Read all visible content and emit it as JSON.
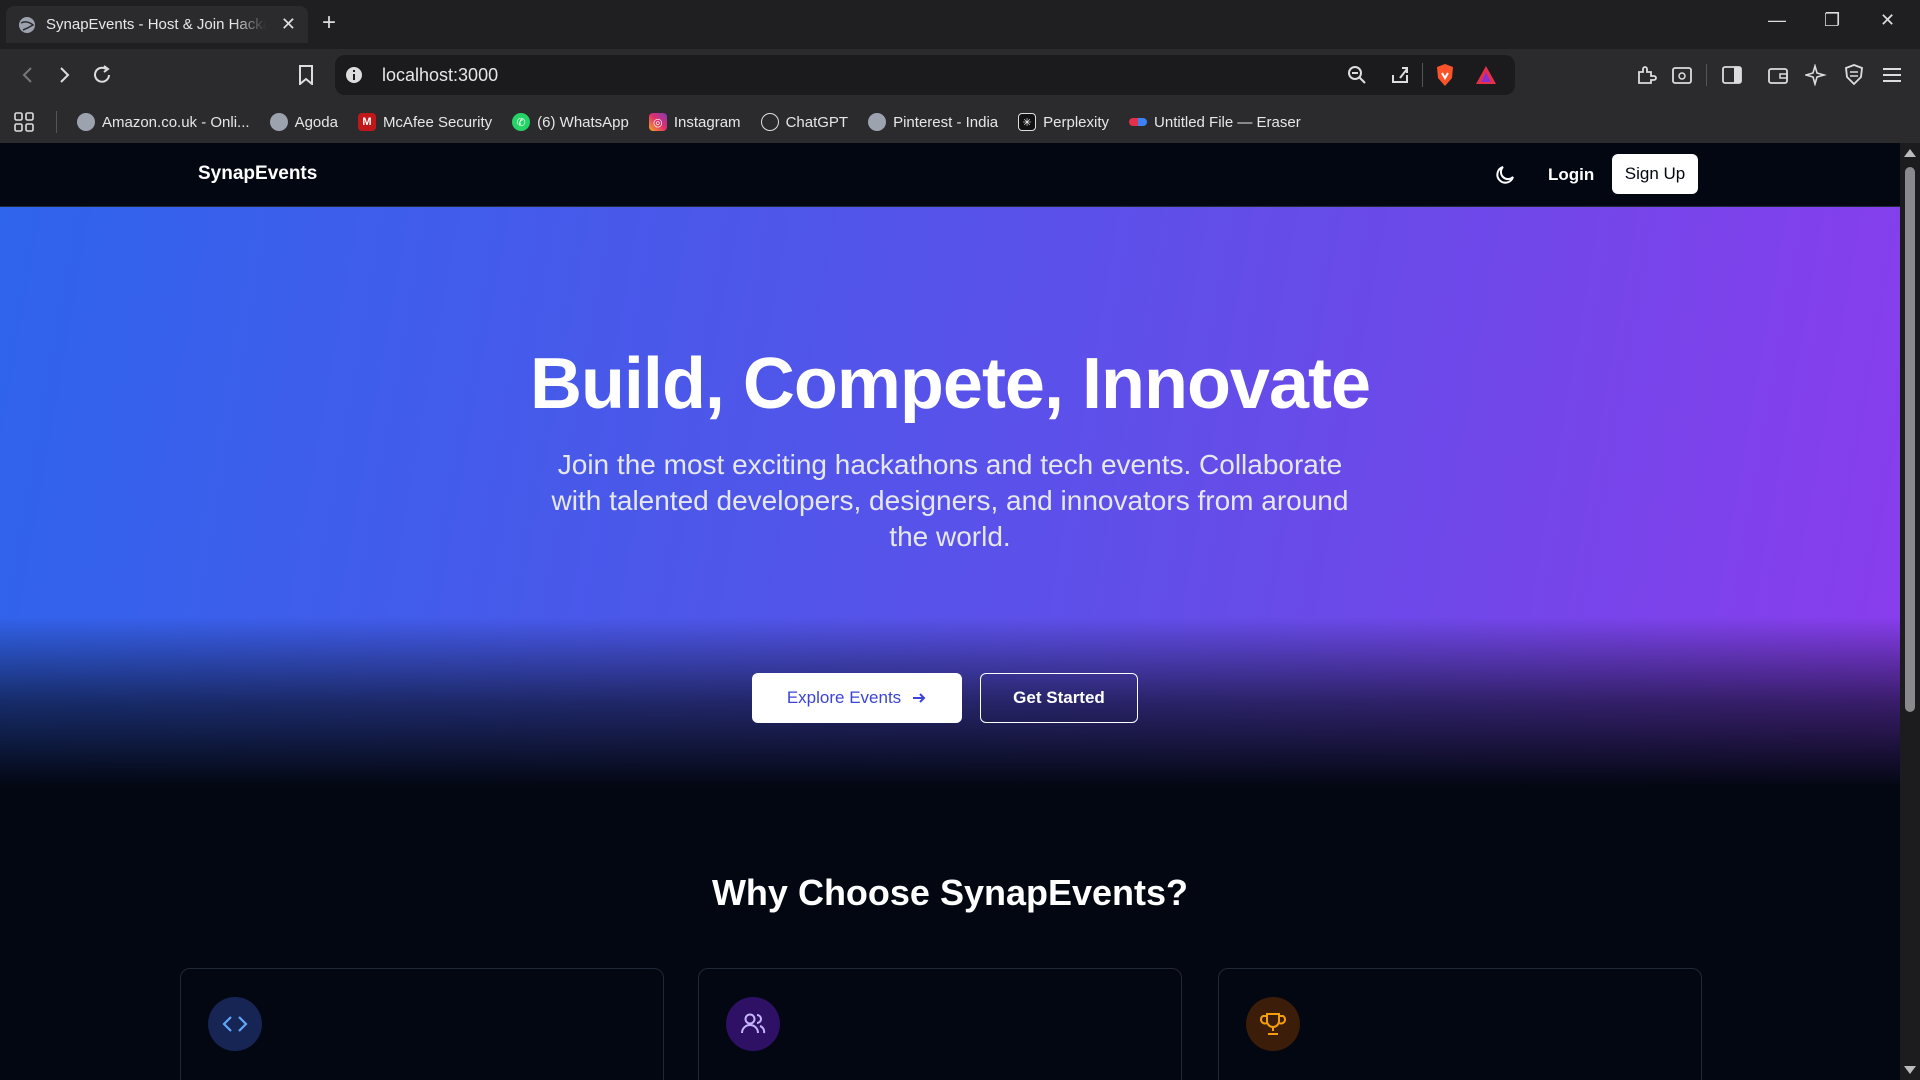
{
  "browser": {
    "tab_title": "SynapEvents - Host & Join Hackathons",
    "url": "localhost:3000",
    "bookmarks": [
      {
        "label": "Amazon.co.uk - Onli...",
        "icon": "globe-icon"
      },
      {
        "label": "Agoda",
        "icon": "globe-icon"
      },
      {
        "label": "McAfee Security",
        "icon": "mcafee-icon"
      },
      {
        "label": "(6) WhatsApp",
        "icon": "whatsapp-icon"
      },
      {
        "label": "Instagram",
        "icon": "instagram-icon"
      },
      {
        "label": "ChatGPT",
        "icon": "chatgpt-icon"
      },
      {
        "label": "Pinterest - India",
        "icon": "globe-icon"
      },
      {
        "label": "Perplexity",
        "icon": "perplexity-icon"
      },
      {
        "label": "Untitled File — Eraser",
        "icon": "eraser-icon"
      }
    ]
  },
  "site": {
    "brand": "SynapEvents",
    "login_label": "Login",
    "signup_label": "Sign Up"
  },
  "hero": {
    "title": "Build, Compete, Innovate",
    "subtitle": "Join the most exciting hackathons and tech events. Collaborate with talented developers, designers, and innovators from around the world.",
    "explore_label": "Explore Events",
    "started_label": "Get Started"
  },
  "features": {
    "heading": "Why Choose SynapEvents?",
    "cards": [
      {
        "icon": "code-icon",
        "color": "#3b82f6"
      },
      {
        "icon": "users-icon",
        "color": "#a78bfa"
      },
      {
        "icon": "trophy-icon",
        "color": "#f59e0b"
      }
    ]
  },
  "colors": {
    "hero_start": "#2f64ec",
    "hero_end": "#8a3ded",
    "background": "#030712"
  }
}
